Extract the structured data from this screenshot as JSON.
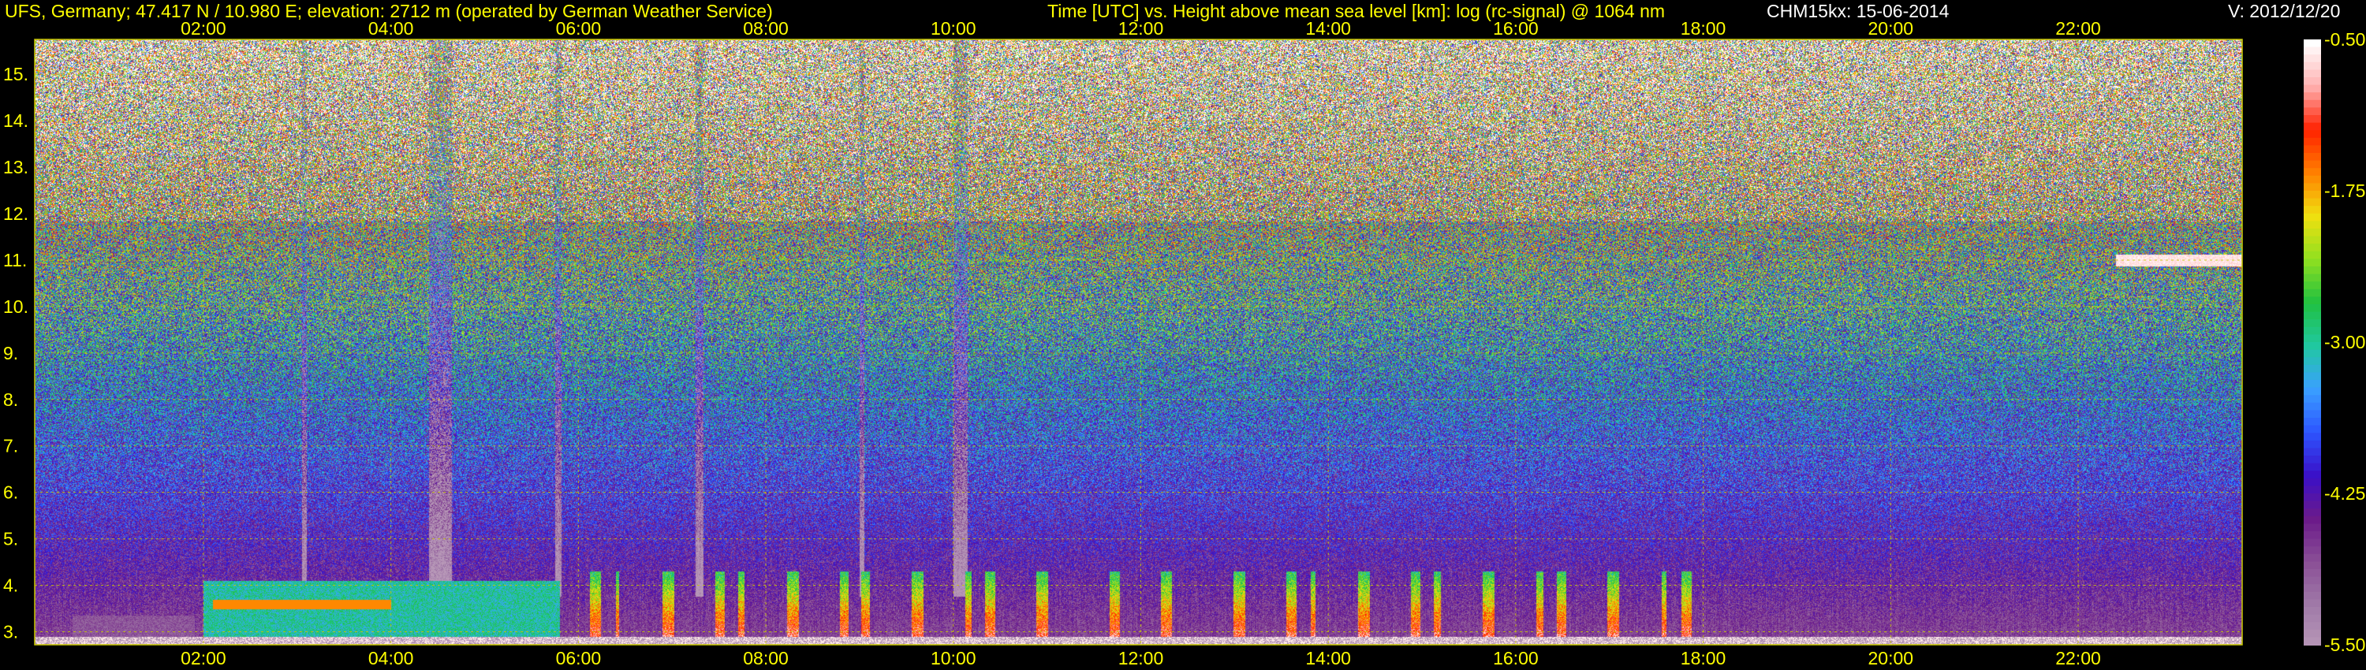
{
  "header": {
    "station": "UFS, Germany; 47.417 N / 10.980 E; elevation: 2712 m  (operated by German Weather Service)",
    "axes_title": "Time [UTC] vs. Height above mean sea level [km]: log (rc-signal) @ 1064 nm",
    "instrument_date": "CHM15kx: 15-06-2014",
    "version": "V: 2012/12/20"
  },
  "colors": {
    "text": "#ffff00",
    "grid": "#c8c800",
    "background": "#000000"
  },
  "chart_data": {
    "type": "heatmap",
    "title": "Time [UTC] vs. Height above mean sea level [km]: log (rc-signal) @ 1064 nm",
    "x_ticks": [
      "02:00",
      "04:00",
      "06:00",
      "08:00",
      "10:00",
      "12:00",
      "14:00",
      "16:00",
      "18:00",
      "20:00",
      "22:00"
    ],
    "x_tick_hours": [
      2,
      4,
      6,
      8,
      10,
      12,
      14,
      16,
      18,
      20,
      22
    ],
    "xlim_hours": [
      0.2,
      23.75
    ],
    "y_ticks": [
      "3.",
      "4.",
      "5.",
      "6.",
      "7.",
      "8.",
      "9.",
      "10.",
      "11.",
      "12.",
      "13.",
      "14.",
      "15."
    ],
    "y_tick_values": [
      3,
      4,
      5,
      6,
      7,
      8,
      9,
      10,
      11,
      12,
      13,
      14,
      15
    ],
    "ylim_km": [
      2.72,
      15.75
    ],
    "grid": true,
    "colorbar": {
      "ticks": [
        "-0.50",
        "-1.75",
        "-3.00",
        "-4.25",
        "-5.50"
      ],
      "tick_values": [
        -0.5,
        -1.75,
        -3.0,
        -4.25,
        -5.5
      ],
      "range": [
        -5.5,
        -0.5
      ],
      "placement": "right",
      "colors": [
        "#b898b8",
        "#a07aa8",
        "#8a4f96",
        "#6b1a8a",
        "#3a10c8",
        "#2d55ff",
        "#3aa0ff",
        "#20c8a0",
        "#20c040",
        "#90e020",
        "#f0e010",
        "#ff8000",
        "#ff2000",
        "#ffb0b0",
        "#ffffff"
      ]
    },
    "features": [
      {
        "kind": "cloud",
        "t_start": 22.4,
        "t_end": 23.75,
        "height_km": 11.0
      },
      {
        "kind": "boundary_layer",
        "t_start": 2.0,
        "t_end": 5.8,
        "height_km": 3.6
      }
    ]
  }
}
